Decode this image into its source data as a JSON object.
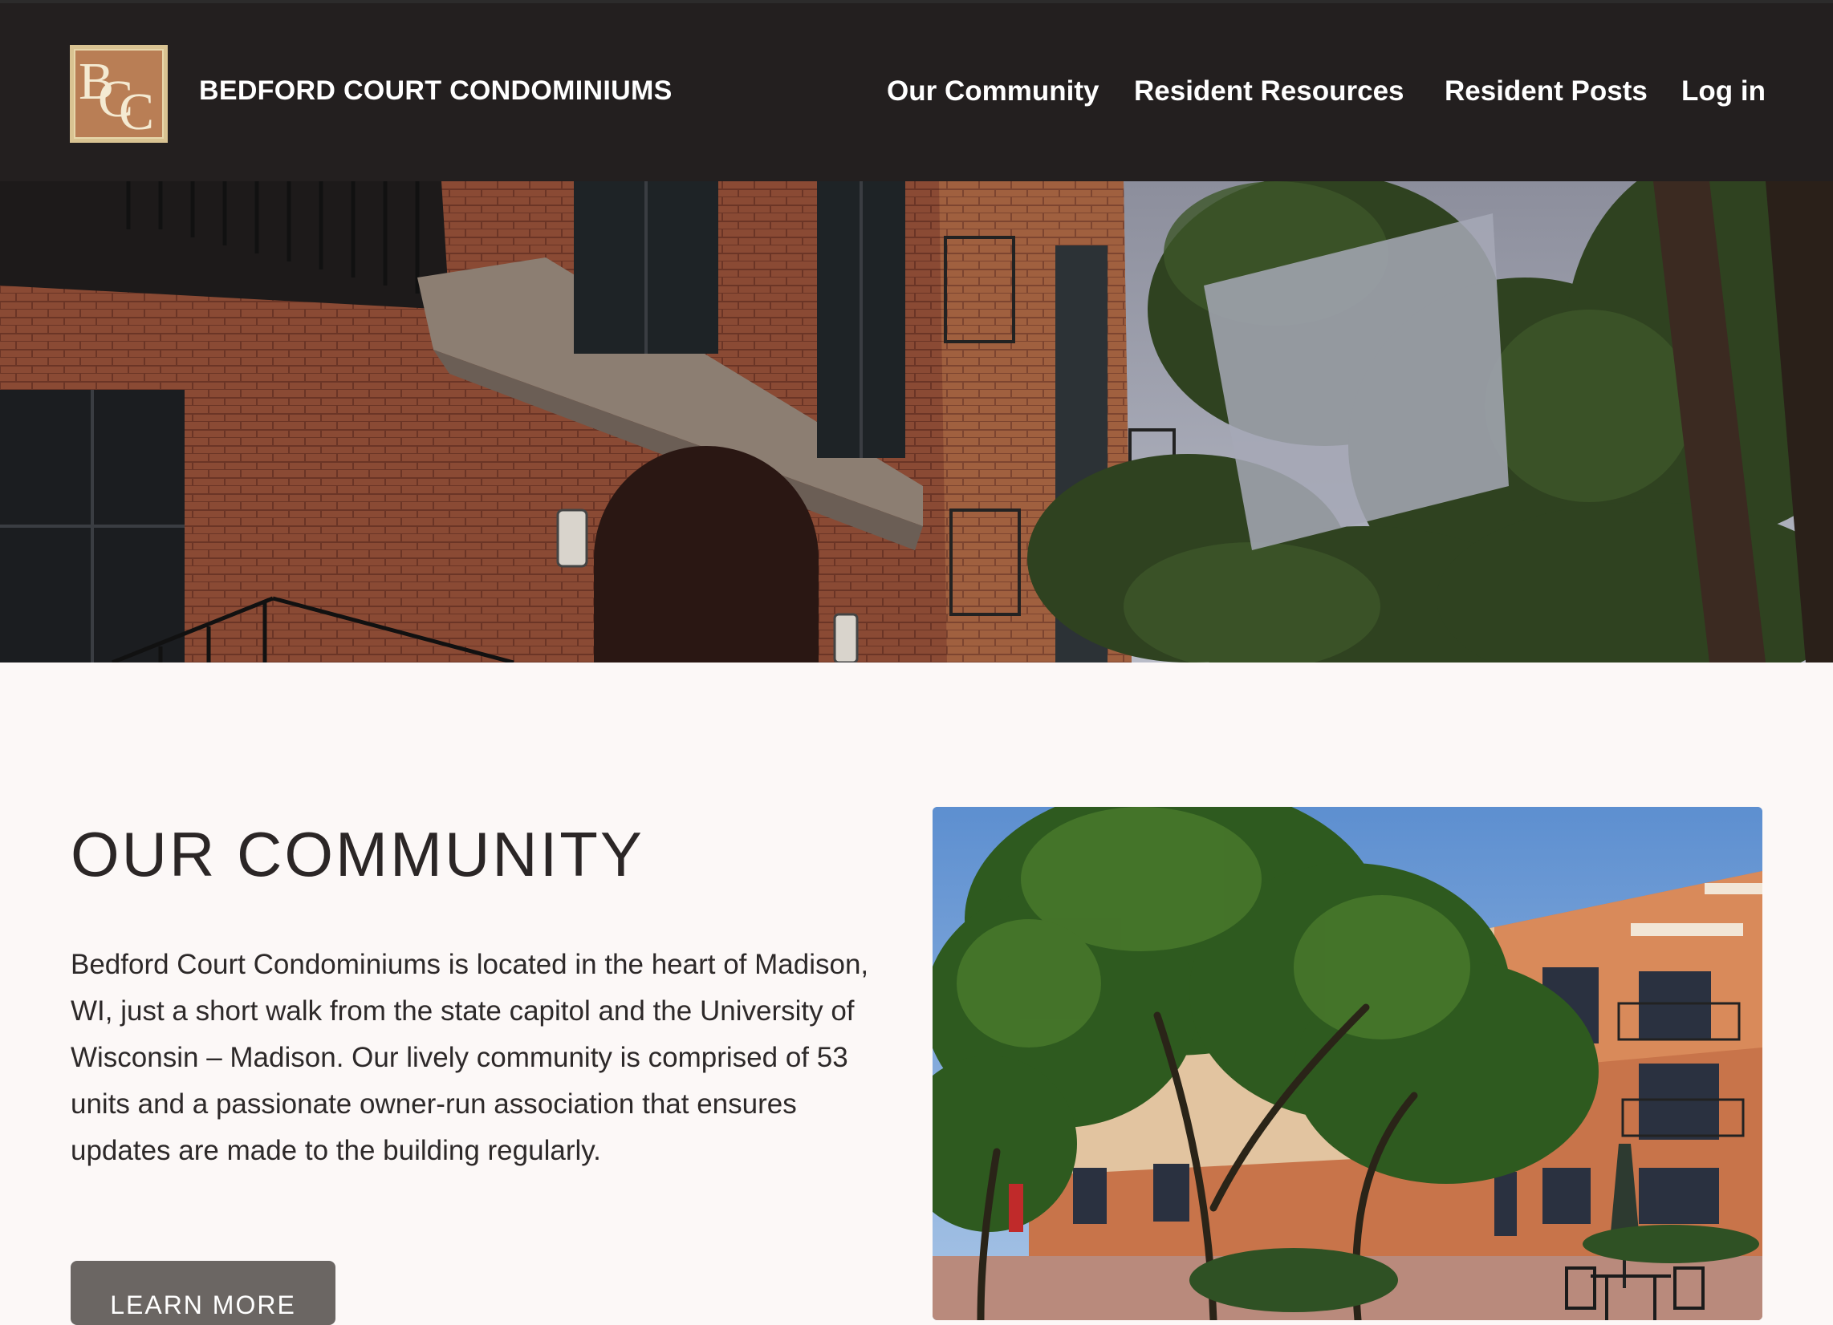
{
  "header": {
    "logo_letters": [
      "B",
      "C",
      "C"
    ],
    "site_title": "BEDFORD COURT CONDOMINIUMS",
    "nav": [
      {
        "label": "Our Community"
      },
      {
        "label": "Resident Resources"
      },
      {
        "label": "Resident Posts"
      },
      {
        "label": "Log in"
      }
    ]
  },
  "community": {
    "heading": "OUR COMMUNITY",
    "body": "Bedford Court Condominiums is located in the heart of Madison, WI, just a short walk from the state capitol and the University of Wisconsin – Madison. Our lively community is comprised of 53 units and a passionate owner-run association that ensures updates are made to the building regularly.",
    "button_label": "LEARN MORE"
  },
  "colors": {
    "header_bg": "#231f1f",
    "page_bg": "#fcf8f7",
    "button_bg": "#6b6663",
    "logo_gold": "#d9c392",
    "logo_brown": "#b97e55"
  }
}
